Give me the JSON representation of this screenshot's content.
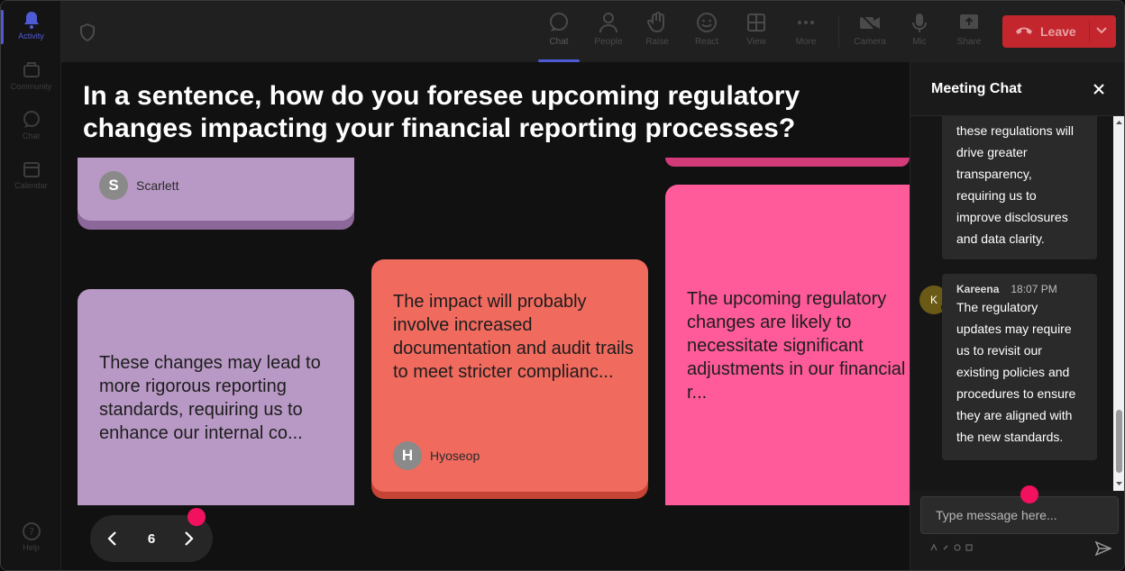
{
  "rail": {
    "items": [
      {
        "label": "Activity",
        "icon": "bell-icon",
        "active": true
      },
      {
        "label": "Community",
        "icon": "community-icon"
      },
      {
        "label": "Chat",
        "icon": "chat-icon"
      },
      {
        "label": "Calendar",
        "icon": "calendar-icon"
      },
      {
        "label": "Help",
        "icon": "help-icon"
      }
    ]
  },
  "toolbar": {
    "buttons": [
      {
        "label": "Chat",
        "icon": "chat-icon",
        "active": true
      },
      {
        "label": "People",
        "icon": "people-icon"
      },
      {
        "label": "Raise",
        "icon": "raise-hand-icon"
      },
      {
        "label": "React",
        "icon": "smiley-icon"
      },
      {
        "label": "View",
        "icon": "grid-icon"
      },
      {
        "label": "More",
        "icon": "more-icon"
      },
      {
        "label": "Camera",
        "icon": "camera-off-icon"
      },
      {
        "label": "Mic",
        "icon": "mic-icon"
      },
      {
        "label": "Share",
        "icon": "share-icon"
      }
    ],
    "leave_label": "Leave",
    "leave_color": "#c4262e"
  },
  "stage": {
    "question": "In a sentence, how do you foresee upcoming regulatory changes impacting your financial reporting processes?",
    "cards": [
      {
        "author": "Scarlett",
        "initial": "S",
        "color": "#b899c5"
      },
      {
        "text": "These changes may lead to more rigorous reporting standards, requiring us to enhance our internal co...",
        "color": "#b899c5"
      },
      {
        "text": "The impact will probably involve increased documentation and audit trails to meet stricter complianc...",
        "author": "Hyoseop",
        "initial": "H",
        "color": "#f06a5e"
      },
      {
        "text": "The upcoming regulatory changes are likely to necessitate significant adjustments in our financial r...",
        "color": "#ff5a99"
      }
    ],
    "page_number": "6",
    "accent_color": "#f2115f"
  },
  "chat": {
    "title": "Meeting Chat",
    "messages": [
      {
        "text": "these regulations will drive greater transparency, requiring us to improve disclosures and data clarity."
      },
      {
        "author": "Kareena",
        "initial": "K",
        "time": "18:07 PM",
        "text": "The regulatory updates may require us to revisit our existing policies and procedures to ensure they are aligned with the new standards."
      }
    ],
    "input_placeholder": "Type message here..."
  }
}
